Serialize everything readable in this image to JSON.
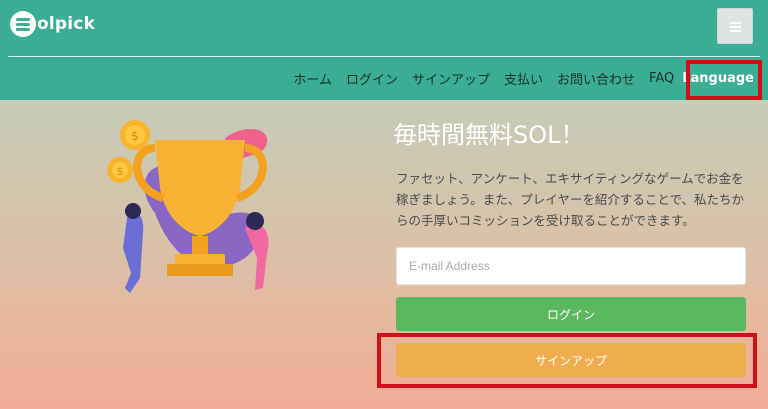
{
  "brand": {
    "logo_text": "olpick"
  },
  "header": {
    "menu_button_icon": "hamburger-icon",
    "nav": [
      {
        "label": "ホーム"
      },
      {
        "label": "ログイン"
      },
      {
        "label": "サインアップ"
      },
      {
        "label": "支払い"
      },
      {
        "label": "お問い合わせ"
      },
      {
        "label": "FAQ"
      },
      {
        "label": "Language"
      }
    ]
  },
  "hero": {
    "title": "毎時間無料SOL！",
    "description": "ファセット、アンケート、エキサイティングなゲームでお金を稼ぎましょう。また、プレイヤーを紹介することで、私たちからの手厚いコミッションを受け取ることができます。",
    "email_placeholder": "E-mail Address",
    "email_value": "",
    "login_label": "ログイン",
    "signup_label": "サインアップ"
  },
  "colors": {
    "header_bg": "#3aae94",
    "login_button": "#5cb85c",
    "signup_button": "#efad4e",
    "highlight": "#d40e16"
  }
}
